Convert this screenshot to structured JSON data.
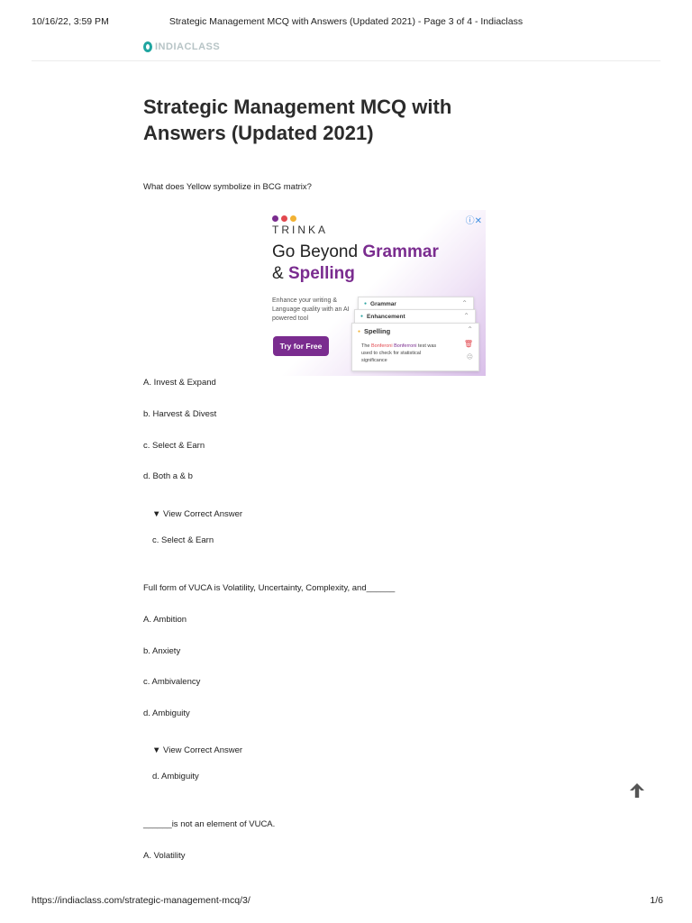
{
  "print_header": {
    "datetime": "10/16/22, 3:59 PM",
    "title": "Strategic Management MCQ with Answers (Updated 2021) - Page 3 of 4 - Indiaclass"
  },
  "print_footer": {
    "url": "https://indiaclass.com/strategic-management-mcq/3/",
    "page": "1/6"
  },
  "site": {
    "logo_text": "INDIACLASS"
  },
  "article": {
    "title": "Strategic Management MCQ with Answers (Updated 2021)"
  },
  "ad": {
    "brand": "TRINKA",
    "close_icon": "adchoices-close-icon",
    "headline_prefix": "Go Beyond ",
    "headline_highlight": "Grammar",
    "headline2_prefix": "& ",
    "headline2_highlight": "Spelling",
    "body": "Enhance your writing & Language quality with an AI powered tool",
    "cta": "Try for Free",
    "cards": [
      {
        "label": "Grammar"
      },
      {
        "label": "Enhancement"
      },
      {
        "label": "Spelling"
      }
    ],
    "suggestion_pre": "The ",
    "suggestion_error": "Bonferoni",
    "suggestion_fix": "Bonferroni",
    "suggestion_post": " test was used to check for statistical significance",
    "colors": {
      "accent": "#7a2c8f",
      "dot1": "#7a2c8f",
      "dot2": "#e2484f",
      "dot3": "#f2b233"
    }
  },
  "questions": [
    {
      "text": "What does Yellow symbolize in BCG matrix?",
      "options": [
        "A. Invest & Expand",
        "b. Harvest & Divest",
        "c. Select & Earn",
        "d. Both a & b"
      ],
      "toggle": "▼ View Correct Answer",
      "answer": "c. Select & Earn"
    },
    {
      "text": "Full form of VUCA is Volatility, Uncertainty, Complexity, and______",
      "options": [
        "A. Ambition",
        "b. Anxiety",
        "c. Ambivalency",
        "d. Ambiguity"
      ],
      "toggle": "▼ View Correct Answer",
      "answer": "d. Ambiguity"
    },
    {
      "text": "______is not an element of VUCA.",
      "options": [
        "A. Volatility"
      ]
    }
  ],
  "scroll_top_icon": "arrow-up-icon"
}
